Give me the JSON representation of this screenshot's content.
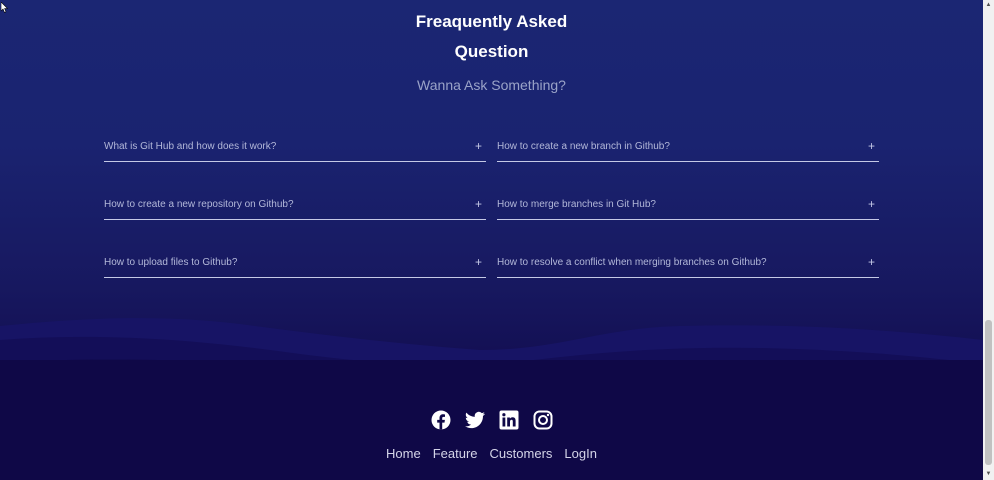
{
  "faq": {
    "title_line1": "Freaquently Asked",
    "title_line2": "Question",
    "subtitle": "Wanna Ask Something?",
    "toggle_symbol": "+",
    "items": [
      {
        "question": "What is Git Hub and how does it work?"
      },
      {
        "question": "How to create a new branch in Github?"
      },
      {
        "question": "How to create a new repository on Github?"
      },
      {
        "question": "How to merge branches in Git Hub?"
      },
      {
        "question": "How to upload files to Github?"
      },
      {
        "question": "How to resolve a conflict when merging branches on Github?"
      }
    ]
  },
  "footer": {
    "social": [
      {
        "icon": "facebook-icon"
      },
      {
        "icon": "twitter-icon"
      },
      {
        "icon": "linkedin-icon"
      },
      {
        "icon": "instagram-icon"
      }
    ],
    "nav": [
      "Home",
      "Feature",
      "Customers",
      "LogIn"
    ]
  },
  "scrollbar": {
    "up_arrow": "▲",
    "down_arrow": "▼"
  },
  "colors": {
    "background_top": "#1b2673",
    "background_bottom": "#0f0847",
    "title": "#ffffff",
    "subtitle": "#9aa3c8",
    "question_text": "#b3b8d9",
    "divider": "#c5c9e6"
  }
}
